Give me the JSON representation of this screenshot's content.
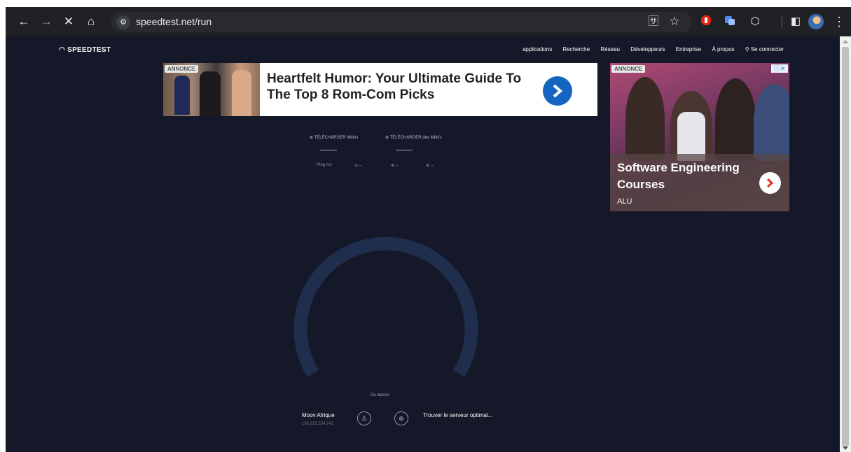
{
  "browser": {
    "url": "speedtest.net/run",
    "back_icon": "←",
    "forward_icon": "→",
    "stop_icon": "✕",
    "home_icon": "⌂",
    "site_info_icon": "⚙",
    "translate_icon": "🈂",
    "star_icon": "☆",
    "extensions_icon": "⬡",
    "sidepanel_icon": "◧",
    "menu_icon": "⋮"
  },
  "site": {
    "logo": "◠ SPEEDTEST",
    "nav": [
      "applications",
      "Recherche",
      "Réseau",
      "Développeurs",
      "Entreprise",
      "À propos",
      "⚲ Se connecter"
    ]
  },
  "ad_banner": {
    "badge": "ANNONCE",
    "headline": "Heartfelt Humor: Your Ultimate Guide To The Top 8 Rom-Com Picks",
    "accent": "#1565c0"
  },
  "side_ad": {
    "badge": "ANNONCE",
    "adchoices": "ⓘ✕",
    "title": "Software Engineering Courses",
    "brand": "ALU"
  },
  "metrics": {
    "download": "⊕ TÉLÉCHARGER Mbit/s",
    "upload": "⊕ TÉLÉCHARGER des Mbit/s",
    "ping_label": "Ping ms",
    "ping_values": [
      "◎ --",
      "⊕ --",
      "⊕ --"
    ]
  },
  "test": {
    "status": "De liaison",
    "isp_name": "Moov Afrique",
    "isp_ip": "102.215.254.242",
    "user_icon": "♙",
    "globe_icon": "⊕",
    "server": "Trouver le serveur optimal..."
  },
  "colors": {
    "page_bg": "#151828",
    "gauge_track": "#1f2e4d"
  }
}
